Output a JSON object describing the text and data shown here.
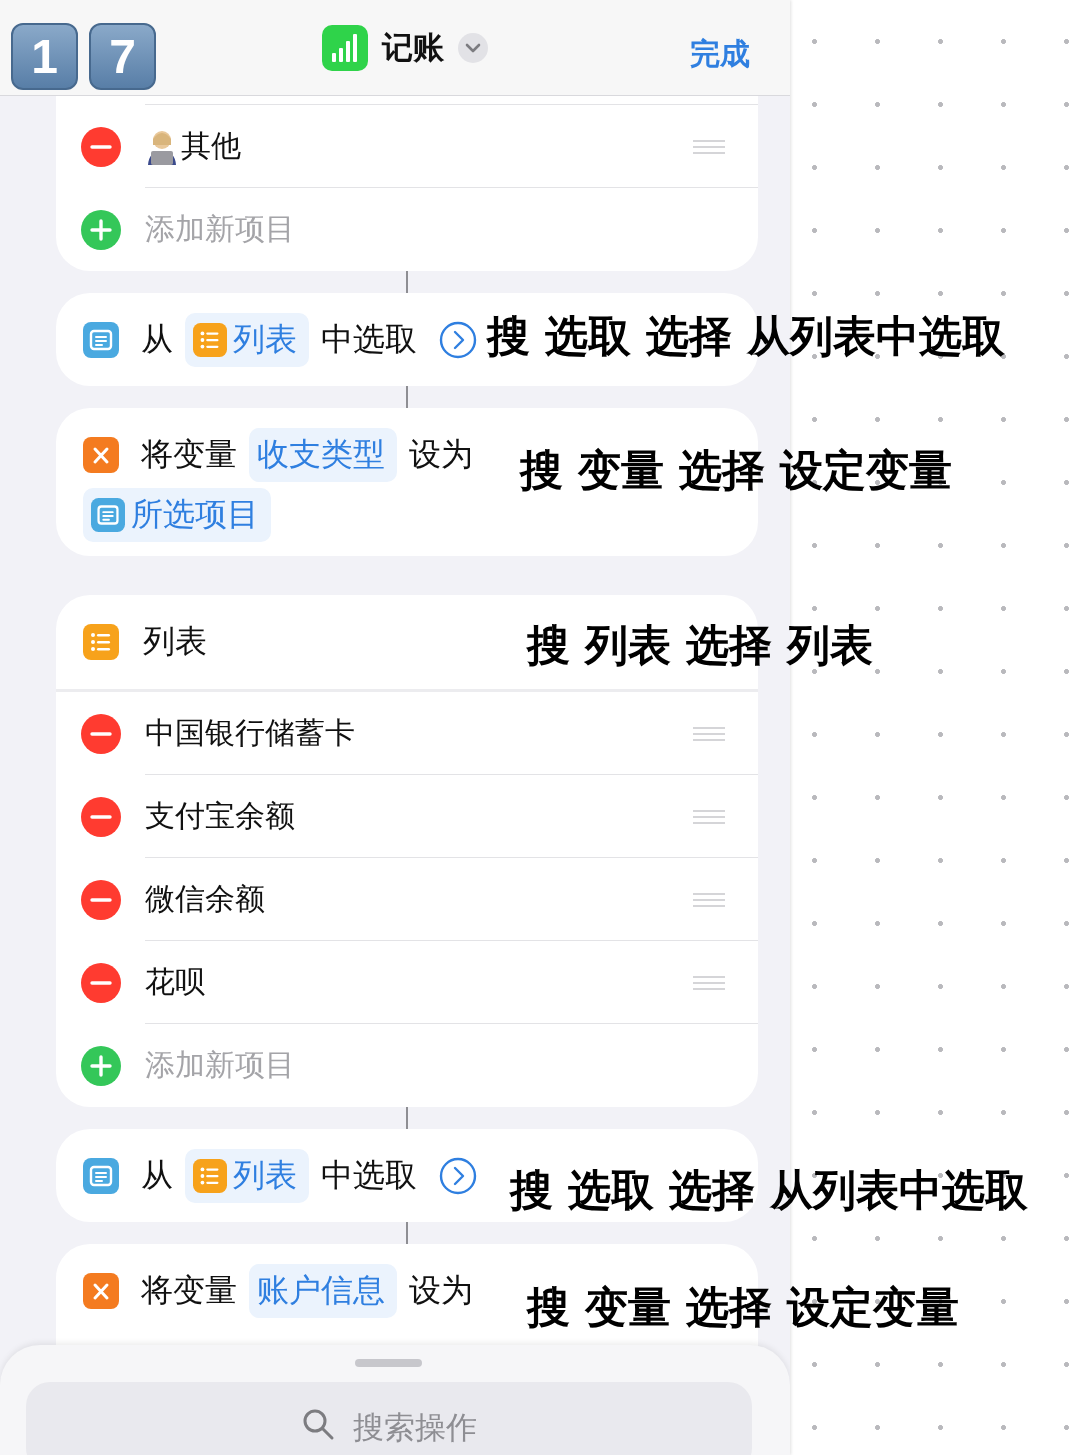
{
  "keycaps": [
    "1",
    "7"
  ],
  "nav": {
    "title": "记账",
    "done": "完成"
  },
  "blocks": [
    {
      "kind": "list",
      "items": [
        {
          "label": "其他",
          "kind": "figure"
        }
      ],
      "add": "添加新项目"
    },
    {
      "kind": "choose",
      "linked_above": true,
      "prefix": "从",
      "token": "列表",
      "suffix": "中选取"
    },
    {
      "kind": "setvar",
      "linked_above": true,
      "prefix": "将变量",
      "token": "收支类型",
      "suffix": "设为",
      "value": "所选项目"
    },
    {
      "kind": "list",
      "linked_above": false,
      "title": "列表",
      "items": [
        {
          "label": "中国银行储蓄卡",
          "kind": "plain"
        },
        {
          "label": "支付宝余额",
          "kind": "plain"
        },
        {
          "label": "微信余额",
          "kind": "plain"
        },
        {
          "label": "花呗",
          "kind": "plain"
        }
      ],
      "add": "添加新项目"
    },
    {
      "kind": "choose",
      "linked_above": true,
      "prefix": "从",
      "token": "列表",
      "suffix": "中选取"
    },
    {
      "kind": "setvar",
      "linked_above": true,
      "prefix": "将变量",
      "token": "账户信息",
      "suffix": "设为"
    }
  ],
  "annotations": [
    "搜 选取 选择 从列表中选取",
    "搜 变量 选择 设定变量",
    "搜 列表 选择 列表",
    "搜 选取 选择 从列表中选取",
    "搜 变量 选择 设定变量"
  ],
  "sheet": {
    "placeholder": "搜索操作"
  }
}
